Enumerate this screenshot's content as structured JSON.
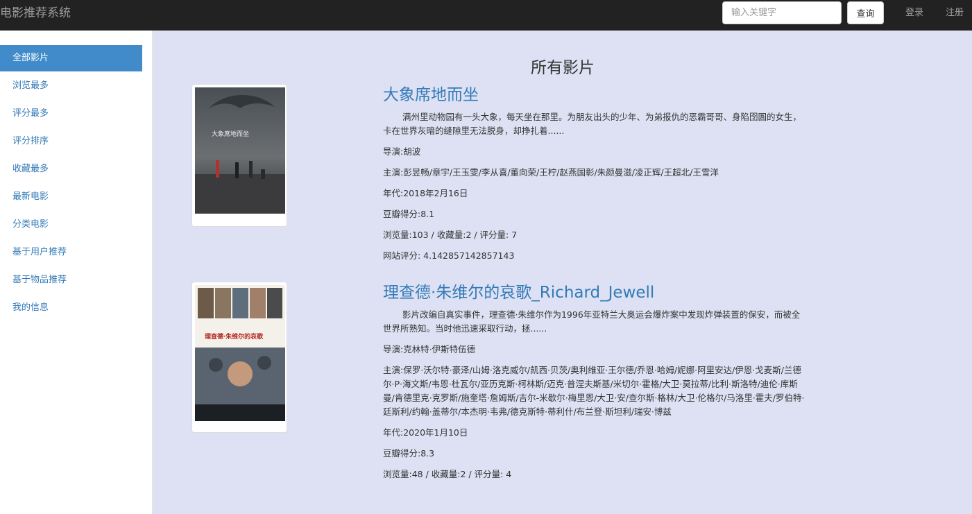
{
  "navbar": {
    "brand": "电影推荐系统",
    "search_placeholder": "输入关键字",
    "search_button": "查询",
    "login": "登录",
    "register": "注册"
  },
  "sidebar": {
    "items": [
      {
        "label": "全部影片",
        "active": true
      },
      {
        "label": "浏览最多"
      },
      {
        "label": "评分最多"
      },
      {
        "label": "评分排序"
      },
      {
        "label": "收藏最多"
      },
      {
        "label": "最新电影"
      },
      {
        "label": "分类电影"
      },
      {
        "label": "基于用户推荐"
      },
      {
        "label": "基于物品推荐"
      },
      {
        "label": "我的信息"
      }
    ]
  },
  "main": {
    "title": "所有影片",
    "movies": [
      {
        "title": "大象席地而坐",
        "description": "满州里动物园有一头大象，每天坐在那里。为朋友出头的少年、为弟报仇的恶霸哥哥、身陷囹圄的女生，卡在世界灰暗的缝隙里无法脱身，却挣扎着......",
        "director": "导演:胡波",
        "cast": "主演:彭昱畅/章宇/王玉雯/李从喜/董向荣/王柠/赵燕国彰/朱颜曼滋/凌正辉/王超北/王雪洋",
        "year": "年代:2018年2月16日",
        "douban": "豆瓣得分:8.1",
        "stats": "浏览量:103 / 收藏量:2 / 评分量: 7",
        "site_score": "网站评分: 4.142857142857143",
        "poster_overlay": "大象席地而坐"
      },
      {
        "title": "理查德·朱维尔的哀歌_Richard_Jewell",
        "description": "影片改编自真实事件，理查德·朱维尔作为1996年亚特兰大奥运会爆炸案中发现炸弹装置的保安，而被全世界所熟知。当时他迅速采取行动，拯......",
        "director": "导演:克林特·伊斯特伍德",
        "cast": "主演:保罗·沃尔特·豪泽/山姆·洛克威尔/凯西·贝茨/奥利维亚·王尔德/乔恩·哈姆/妮娜·阿里安达/伊恩·戈麦斯/兰德尔·P·海文斯/韦恩·杜瓦尔/亚历克斯·柯林斯/迈克·普涅夫斯基/米切尔·霍格/大卫·莫拉蒂/比利·斯洛特/迪伦·库斯曼/肯德里克·克罗斯/施奎塔·詹姆斯/吉尔-米歇尔·梅里恩/大卫·安/查尔斯·格林/大卫·伦格尔/马洛里·霍夫/罗伯特·廷斯利/约翰·盖蒂尔/本杰明·韦弗/德克斯特·蒂利什/布兰登·斯坦利/瑞安·博兹",
        "year": "年代:2020年1月10日",
        "douban": "豆瓣得分:8.3",
        "stats": "浏览量:48 / 收藏量:2 / 评分量: 4",
        "poster_overlay": "理查德·朱维尔的哀歌"
      }
    ]
  },
  "colors": {
    "navbar_bg": "#222222",
    "accent": "#428bca",
    "link": "#337ab7",
    "main_bg": "#dde1f3"
  }
}
